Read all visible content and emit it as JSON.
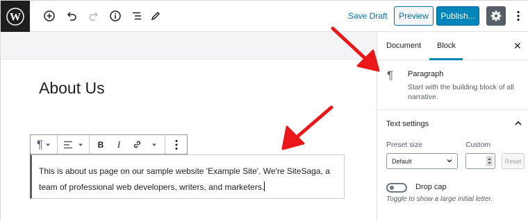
{
  "topbar": {
    "logo_icon": "wordpress-logo-icon",
    "add_icon": "plus-circle-icon",
    "undo_icon": "undo-icon",
    "redo_icon": "redo-icon",
    "info_icon": "info-icon",
    "outline_icon": "list-outline-icon",
    "tools_icon": "pencil-icon",
    "save_draft_label": "Save Draft",
    "preview_label": "Preview",
    "publish_label": "Publish...",
    "settings_icon": "gear-icon",
    "more_icon": "more-vertical-icon"
  },
  "editor": {
    "title": "About Us",
    "paragraph_line1": "This is about us page on our sample website 'Example Site'. We're SiteSaga, a",
    "paragraph_line2": "team of  professional web developers, writers, and marketers."
  },
  "block_toolbar": {
    "paragraph_icon": "pilcrow-icon",
    "align_icon": "align-left-icon",
    "bold_label": "B",
    "italic_label": "I",
    "link_icon": "link-icon",
    "more_icon": "more-vertical-icon"
  },
  "sidebar": {
    "tabs": [
      "Document",
      "Block"
    ],
    "active_tab": "Block",
    "block_card": {
      "title": "Paragraph",
      "description": "Start with the building block of all narrative."
    },
    "text_settings": {
      "panel_title": "Text settings",
      "preset_label": "Preset size",
      "preset_value": "Default",
      "custom_label": "Custom",
      "reset_label": "Reset",
      "drop_cap_label": "Drop cap",
      "drop_cap_help": "Toggle to show a large initial letter."
    }
  },
  "colors": {
    "accent": "#0085ba",
    "arrow": "#e8181b",
    "dark": "#1e1e1e"
  }
}
